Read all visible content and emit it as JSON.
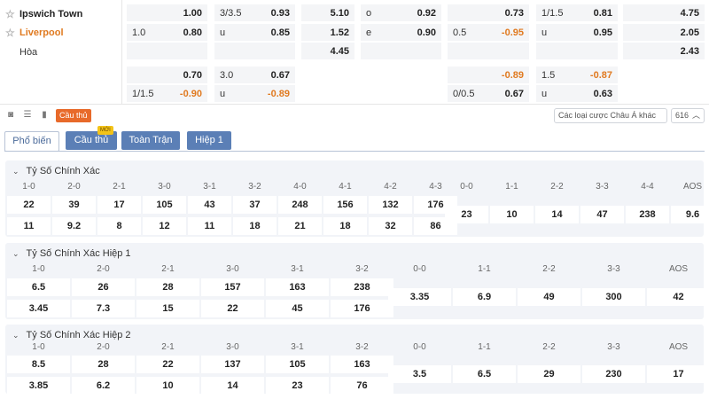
{
  "teams": {
    "home": "Ipswich Town",
    "away": "Liverpool",
    "draw": "Hòa"
  },
  "odds_rows": [
    [
      {
        "h": "",
        "v": "1.00"
      },
      {
        "h": "3/3.5",
        "v": "0.93"
      },
      {
        "h": "",
        "v": "5.10"
      },
      {
        "h": "o",
        "v": "0.92"
      },
      {
        "h": "",
        "v": "0.73"
      },
      {
        "h": "1/1.5",
        "v": "0.81"
      },
      {
        "h": "",
        "v": "4.75"
      }
    ],
    [
      {
        "h": "1.0",
        "v": "0.80"
      },
      {
        "h": "u",
        "v": "0.85"
      },
      {
        "h": "",
        "v": "1.52"
      },
      {
        "h": "e",
        "v": "0.90"
      },
      {
        "h": "0.5",
        "v": "-0.95"
      },
      {
        "h": "u",
        "v": "0.95"
      },
      {
        "h": "",
        "v": "2.05"
      }
    ],
    [
      {
        "h": "",
        "v": ""
      },
      {
        "h": "",
        "v": ""
      },
      {
        "h": "",
        "v": "4.45"
      },
      {
        "h": "",
        "v": ""
      },
      {
        "h": "",
        "v": ""
      },
      {
        "h": "",
        "v": ""
      },
      {
        "h": "",
        "v": "2.43"
      }
    ],
    [
      {
        "h": "",
        "v": "0.70"
      },
      {
        "h": "3.0",
        "v": "0.67"
      },
      null,
      null,
      {
        "h": "",
        "v": "-0.89"
      },
      {
        "h": "1.5",
        "v": "-0.87"
      },
      null
    ],
    [
      {
        "h": "1/1.5",
        "v": "-0.90"
      },
      {
        "h": "u",
        "v": "-0.89"
      },
      null,
      null,
      {
        "h": "0/0.5",
        "v": "0.67"
      },
      {
        "h": "u",
        "v": "0.63"
      },
      null
    ]
  ],
  "toolbar": {
    "player_badge": "Cầu thủ",
    "bet_type": "Các loại cược Châu Á khác",
    "count": "616",
    "icons": [
      "camera-icon",
      "list-icon",
      "chart-icon"
    ]
  },
  "tabs": [
    {
      "label": "Phổ biến",
      "active": true
    },
    {
      "label": "Cầu thủ",
      "active": false,
      "badge": "MỚI"
    },
    {
      "label": "Toàn Trận",
      "active": false
    },
    {
      "label": "Hiệp 1",
      "active": false
    }
  ],
  "sections": [
    {
      "title": "Tỷ Số Chính Xác",
      "left": {
        "headers": [
          "1-0",
          "2-0",
          "2-1",
          "3-0",
          "3-1",
          "3-2",
          "4-0",
          "4-1",
          "4-2",
          "4-3"
        ],
        "row1": [
          "22",
          "39",
          "17",
          "105",
          "43",
          "37",
          "248",
          "156",
          "132",
          "176"
        ],
        "row2": [
          "11",
          "9.2",
          "8",
          "12",
          "11",
          "18",
          "21",
          "18",
          "32",
          "86"
        ]
      },
      "right": {
        "headers": [
          "0-0",
          "1-1",
          "2-2",
          "3-3",
          "4-4",
          "AOS"
        ],
        "values": [
          "23",
          "10",
          "14",
          "47",
          "238",
          "9.6"
        ]
      }
    },
    {
      "title": "Tỷ Số Chính Xác Hiệp 1",
      "left": {
        "headers": [
          "1-0",
          "2-0",
          "2-1",
          "3-0",
          "3-1",
          "3-2"
        ],
        "row1": [
          "6.5",
          "26",
          "28",
          "157",
          "163",
          "238"
        ],
        "row2": [
          "3.45",
          "7.3",
          "15",
          "22",
          "45",
          "176"
        ]
      },
      "right": {
        "headers": [
          "0-0",
          "1-1",
          "2-2",
          "3-3",
          "AOS"
        ],
        "values": [
          "3.35",
          "6.9",
          "49",
          "300",
          "42"
        ]
      }
    },
    {
      "title": "Tỷ Số Chính Xác Hiệp 2",
      "left": {
        "headers": [
          "1-0",
          "2-0",
          "2-1",
          "3-0",
          "3-1",
          "3-2"
        ],
        "row1": [
          "8.5",
          "28",
          "22",
          "137",
          "105",
          "163"
        ],
        "row2": [
          "3.85",
          "6.2",
          "10",
          "14",
          "23",
          "76"
        ]
      },
      "right": {
        "headers": [
          "0-0",
          "1-1",
          "2-2",
          "3-3",
          "AOS"
        ],
        "values": [
          "3.5",
          "6.5",
          "29",
          "230",
          "17"
        ]
      }
    }
  ]
}
